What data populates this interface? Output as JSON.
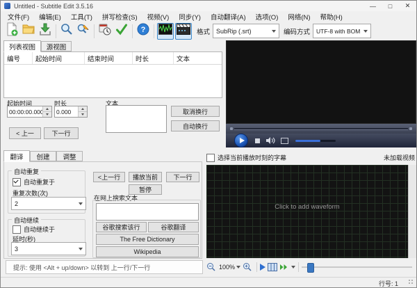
{
  "window": {
    "title": "Untitled - Subtitle Edit 3.5.16",
    "minimize": "—",
    "maximize": "□",
    "close": "✕"
  },
  "menu": {
    "items": [
      "文件(F)",
      "编辑(E)",
      "工具(T)",
      "拼写检查(S)",
      "视频(V)",
      "同步(Y)",
      "自动翻译(A)",
      "选项(O)",
      "网络(N)",
      "帮助(H)"
    ]
  },
  "toolbar": {
    "icons": [
      "new-file",
      "open-folder",
      "save",
      "find",
      "replace",
      "visual-sync",
      "spell-check",
      "help",
      "waveform-toggle",
      "video-toggle"
    ],
    "format_label": "格式",
    "format_value": "SubRip (.srt)",
    "encoding_label": "编码方式",
    "encoding_value": "UTF-8 with BOM"
  },
  "list_panel": {
    "tabs": [
      "列表视图",
      "源视图"
    ],
    "columns": [
      "编号",
      "起始时间",
      "结束时间",
      "时长",
      "文本"
    ]
  },
  "edit_panel": {
    "start_time_label": "起始时间",
    "start_time_value": "00:00:00.000",
    "duration_label": "时长",
    "duration_value": "0.000",
    "text_label": "文本",
    "unbreak_button": "取消换行",
    "auto_break_button": "自动换行",
    "prev_button": "< 上一",
    "next_button": "下一行"
  },
  "mode_panel": {
    "tabs": [
      "翻译",
      "创建",
      "调整"
    ],
    "auto_repeat": {
      "title": "自动重复",
      "checkbox_label": "自动重复于",
      "checked": true,
      "count_label": "重复次数(次)",
      "count_value": "2"
    },
    "auto_continue": {
      "title": "自动继续",
      "checkbox_label": "自动继续于",
      "checked": false,
      "delay_label": "延时(秒)",
      "delay_value": "3"
    },
    "prev_line_button": "<上一行",
    "play_current_button": "播放当前",
    "next_line_button": "下一行",
    "pause_button": "暂停",
    "web_search_label": "在网上搜索文本",
    "google_search_button": "谷歌搜索该行",
    "google_translate_button": "谷歌翻译",
    "free_dictionary_button": "The Free Dictionary",
    "wikipedia_button": "Wikipedia"
  },
  "hint_bar": {
    "text": "提示: 使用 <Alt + up/down> 以转到 上一行/下一行"
  },
  "video_panel": {
    "select_subtitle_checkbox": "选择当前播放时刻的字幕",
    "checked": false,
    "status_label": "未加载视频"
  },
  "waveform_panel": {
    "placeholder": "Click to add waveform",
    "zoom_value": "100%"
  },
  "status_bar": {
    "line_number": "行号: 1"
  },
  "colors": {
    "accent_blue": "#0078d4",
    "waveform_green": "#51e851",
    "player_bar": "#2b3040",
    "volume_blue": "#3a6fd8"
  }
}
